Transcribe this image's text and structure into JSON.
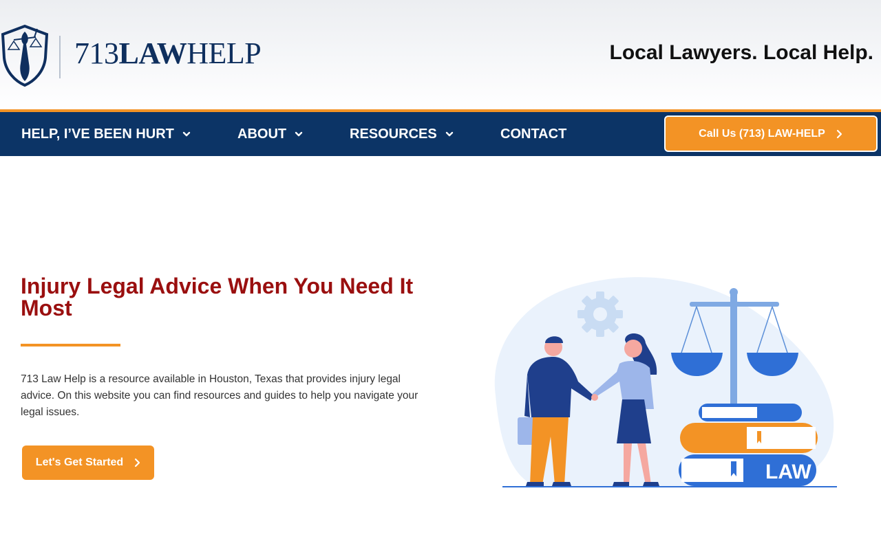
{
  "header": {
    "logo": {
      "prefix": "713",
      "bold": "LAW",
      "suffix": "HELP",
      "icon": "lady-justice-shield-icon"
    },
    "tagline": "Local Lawyers. Local Help."
  },
  "nav": {
    "items": [
      {
        "label": "HELP, I’VE BEEN HURT",
        "has_dropdown": true
      },
      {
        "label": "ABOUT",
        "has_dropdown": true
      },
      {
        "label": "RESOURCES",
        "has_dropdown": true
      },
      {
        "label": "CONTACT",
        "has_dropdown": false
      }
    ],
    "call_button": "Call Us (713) LAW-HELP"
  },
  "hero": {
    "title": "Injury Legal Advice When You Need It Most",
    "description": "713 Law Help is a resource available in Houston, Texas that provides injury legal advice. On this website you can find resources and guides to help you navigate your legal issues.",
    "button_label": "Let's Get Started",
    "illustration": {
      "icon": "handshake-law-scales-illustration",
      "book_label": "LAW"
    }
  },
  "colors": {
    "navy": "#0c3466",
    "orange": "#f39325",
    "title_red": "#9a0f0f",
    "illustration_blue": "#2f6fd6"
  }
}
